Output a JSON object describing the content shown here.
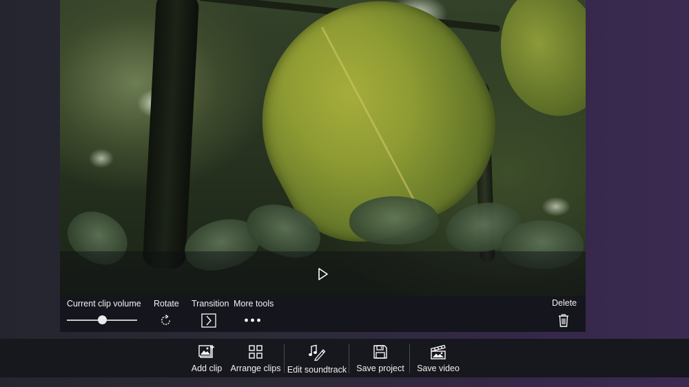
{
  "clip_tools": {
    "volume": {
      "label": "Current clip volume",
      "value_fraction": 0.5
    },
    "rotate": {
      "label": "Rotate",
      "icon": "rotate-icon"
    },
    "transition": {
      "label": "Transition",
      "icon": "transition-icon"
    },
    "more_tools": {
      "label": "More tools",
      "icon": "more-icon"
    },
    "delete": {
      "label": "Delete",
      "icon": "trash-icon"
    }
  },
  "playback": {
    "icon": "play-icon"
  },
  "command_bar": {
    "items": [
      {
        "label": "Add clip",
        "icon": "add-clip-icon"
      },
      {
        "label": "Arrange clips",
        "icon": "grid-icon"
      },
      {
        "label": "Edit soundtrack",
        "icon": "music-note-icon"
      },
      {
        "label": "Save project",
        "icon": "save-icon"
      },
      {
        "label": "Save video",
        "icon": "clapperboard-icon"
      }
    ]
  },
  "colors": {
    "toolbar_bg": "#15151d",
    "commandbar_bg": "#17171e",
    "text": "#f2f2f2"
  }
}
